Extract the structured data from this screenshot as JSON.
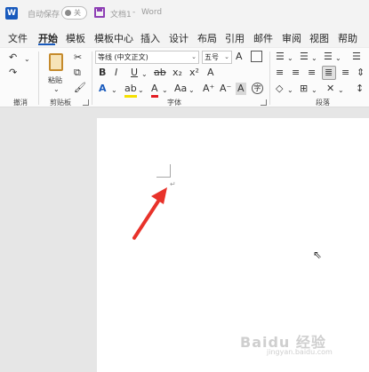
{
  "titlebar": {
    "app_icon_letter": "W",
    "autosave_label": "自动保存",
    "autosave_state": "关",
    "document_name": "文档1",
    "separator": "-",
    "app_name": "Word"
  },
  "menu_tabs": [
    "文件",
    "开始",
    "模板",
    "模板中心",
    "插入",
    "设计",
    "布局",
    "引用",
    "邮件",
    "审阅",
    "视图",
    "帮助"
  ],
  "active_tab": "开始",
  "ribbon": {
    "undo_group_label": "撤消",
    "clipboard_group_label": "剪贴板",
    "paste_label": "粘贴",
    "font_group_label": "字体",
    "paragraph_group_label": "段落",
    "font_name": "等线 (中文正文)",
    "font_size": "五号",
    "font_buttons": [
      "B",
      "I",
      "U",
      "ab",
      "x₂",
      "x²",
      "A"
    ],
    "font_color_buttons": [
      "A",
      "ab",
      "A",
      "Aa",
      "A⁺",
      "A⁻",
      "A",
      "字"
    ],
    "icon_colors": {
      "highlight": "#f5e000",
      "font_color": "#e31c23",
      "accent": "#185abd"
    }
  },
  "watermark": {
    "text": "Baidu 经验",
    "sub": "jingyan.baidu.com"
  }
}
